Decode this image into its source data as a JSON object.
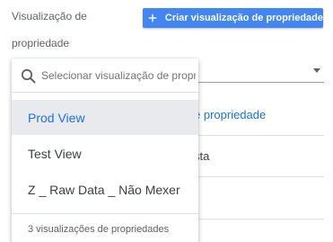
{
  "view_label": {
    "line1": "Visualização de",
    "line2": "propriedade"
  },
  "create_button": {
    "label": "Criar visualização de propriedade",
    "icon": "plus-icon",
    "color": "#4285f4"
  },
  "background_rows": {
    "row1_text": "e propriedade",
    "row2_text": "sta"
  },
  "dropdown": {
    "search": {
      "placeholder": "Selecionar visualização de propriedade",
      "value": "",
      "icon": "search-icon"
    },
    "options": [
      {
        "label": "Prod View",
        "selected": true
      },
      {
        "label": "Test View",
        "selected": false
      },
      {
        "label": "Z _ Raw Data _ Não Mexer",
        "selected": false
      }
    ],
    "footer": "3 visualizações de propriedades"
  },
  "colors": {
    "accent": "#1a73e8",
    "selected_bg": "#e8eaed"
  }
}
